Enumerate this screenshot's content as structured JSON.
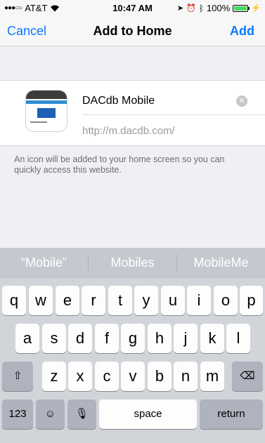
{
  "status_bar": {
    "carrier": "AT&T",
    "signal_dots": "●●●○○",
    "time": "10:47 AM",
    "battery": "100%",
    "battery_level": 1.0
  },
  "nav": {
    "cancel": "Cancel",
    "title": "Add to Home",
    "add": "Add"
  },
  "bookmark": {
    "name": "DACdb Mobile",
    "url": "http://m.dacdb.com/"
  },
  "note": "An icon will be added to your home screen so you can quickly access this website.",
  "keyboard": {
    "predictions": [
      "“Mobile”",
      "Mobiles",
      "MobileMe"
    ],
    "row1": [
      "q",
      "w",
      "e",
      "r",
      "t",
      "y",
      "u",
      "i",
      "o",
      "p"
    ],
    "row2": [
      "a",
      "s",
      "d",
      "f",
      "g",
      "h",
      "j",
      "k",
      "l"
    ],
    "row3": [
      "z",
      "x",
      "c",
      "v",
      "b",
      "n",
      "m"
    ],
    "numbers": "123",
    "space": "space",
    "return": "return"
  },
  "colors": {
    "accent": "#0a7aff",
    "battery": "#4cd964"
  }
}
